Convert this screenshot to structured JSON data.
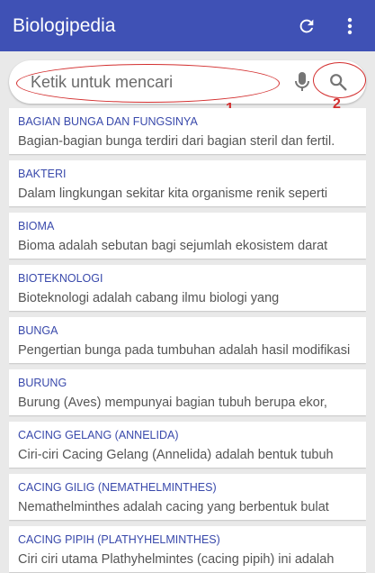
{
  "appbar": {
    "title": "Biologipedia",
    "refresh_icon": "refresh-icon",
    "menu_icon": "more-vert-icon",
    "color": "#3f51b5"
  },
  "search": {
    "placeholder": "Ketik untuk mencari",
    "mic_icon": "mic-icon",
    "search_icon": "search-icon"
  },
  "annotations": {
    "label_1": "1",
    "label_2": "2",
    "color": "#d32f2f"
  },
  "entries": [
    {
      "title": "BAGIAN BUNGA DAN FUNGSINYA",
      "desc": "Bagian-bagian bunga terdiri dari bagian steril dan fertil."
    },
    {
      "title": "BAKTERI",
      "desc": "Dalam lingkungan sekitar kita organisme renik seperti"
    },
    {
      "title": "BIOMA",
      "desc": "Bioma adalah sebutan bagi sejumlah ekosistem darat"
    },
    {
      "title": "BIOTEKNOLOGI",
      "desc": "Bioteknologi adalah cabang ilmu biologi yang"
    },
    {
      "title": "BUNGA",
      "desc": "Pengertian bunga pada tumbuhan adalah hasil modifikasi"
    },
    {
      "title": "BURUNG",
      "desc": "Burung (Aves) mempunyai bagian tubuh berupa ekor,"
    },
    {
      "title": "CACING GELANG (ANNELIDA)",
      "desc": "Ciri-ciri Cacing Gelang (Annelida) adalah bentuk tubuh"
    },
    {
      "title": "CACING GILIG (NEMATHELMINTHES)",
      "desc": "Nemathelminthes adalah cacing yang berbentuk bulat"
    },
    {
      "title": "CACING PIPIH (PLATHYHELMINTHES)",
      "desc": "Ciri ciri utama Plathyhelmintes (cacing pipih) ini adalah"
    }
  ]
}
